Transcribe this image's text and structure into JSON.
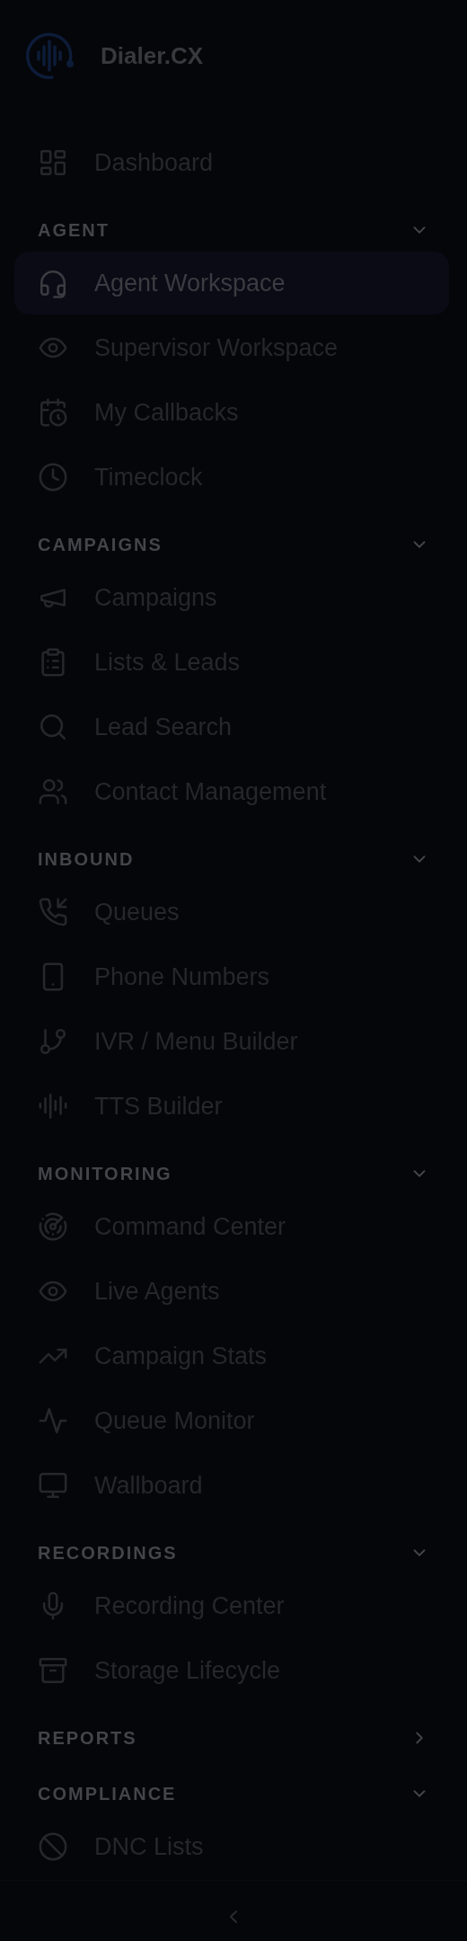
{
  "brand": {
    "title": "Dialer.CX"
  },
  "top_items": [
    {
      "label": "Dashboard",
      "selected": false
    }
  ],
  "sections": [
    {
      "title": "AGENT",
      "expanded": true,
      "items": [
        {
          "label": "Agent Workspace",
          "selected": true
        },
        {
          "label": "Supervisor Workspace",
          "selected": false
        },
        {
          "label": "My Callbacks",
          "selected": false
        },
        {
          "label": "Timeclock",
          "selected": false
        }
      ]
    },
    {
      "title": "CAMPAIGNS",
      "expanded": true,
      "items": [
        {
          "label": "Campaigns",
          "selected": false
        },
        {
          "label": "Lists & Leads",
          "selected": false
        },
        {
          "label": "Lead Search",
          "selected": false
        },
        {
          "label": "Contact Management",
          "selected": false
        }
      ]
    },
    {
      "title": "INBOUND",
      "expanded": true,
      "items": [
        {
          "label": "Queues",
          "selected": false
        },
        {
          "label": "Phone Numbers",
          "selected": false
        },
        {
          "label": "IVR / Menu Builder",
          "selected": false
        },
        {
          "label": "TTS Builder",
          "selected": false
        }
      ]
    },
    {
      "title": "MONITORING",
      "expanded": true,
      "items": [
        {
          "label": "Command Center",
          "selected": false
        },
        {
          "label": "Live Agents",
          "selected": false
        },
        {
          "label": "Campaign Stats",
          "selected": false
        },
        {
          "label": "Queue Monitor",
          "selected": false
        },
        {
          "label": "Wallboard",
          "selected": false
        }
      ]
    },
    {
      "title": "RECORDINGS",
      "expanded": true,
      "items": [
        {
          "label": "Recording Center",
          "selected": false
        },
        {
          "label": "Storage Lifecycle",
          "selected": false
        }
      ]
    },
    {
      "title": "REPORTS",
      "expanded": false
    },
    {
      "title": "COMPLIANCE",
      "expanded": true,
      "items": [
        {
          "label": "DNC Lists",
          "selected": false
        }
      ]
    }
  ]
}
